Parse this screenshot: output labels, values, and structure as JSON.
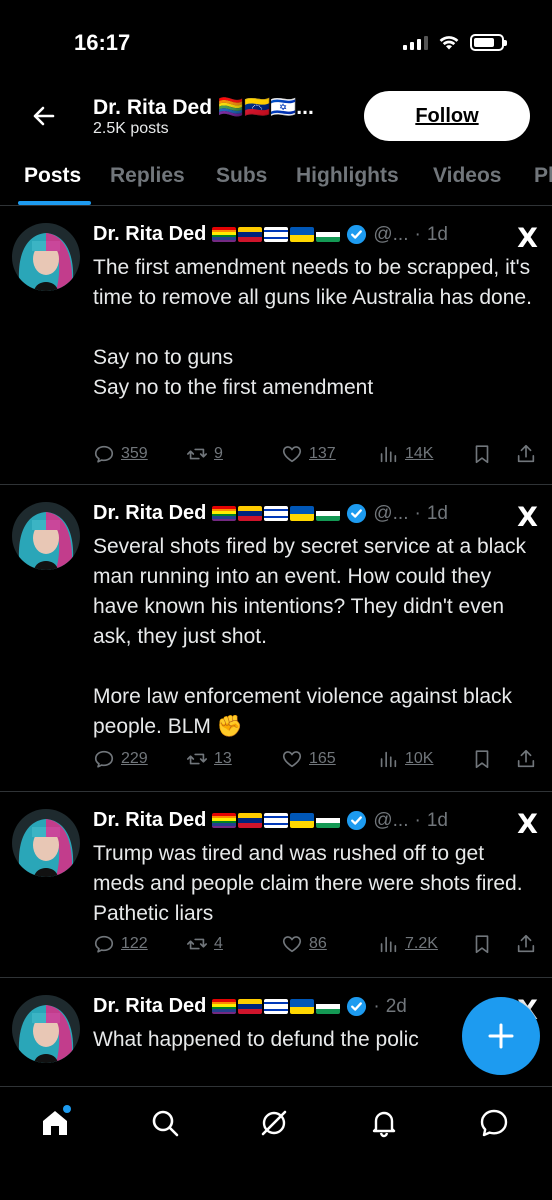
{
  "status_bar": {
    "time": "16:17",
    "battery_level": 0.75
  },
  "header": {
    "profile_name": "Dr. Rita Ded 🏳️‍🌈🇻🇪🇮🇱...",
    "post_count": "2.5K posts",
    "follow_label": "Follow"
  },
  "tabs": [
    "Posts",
    "Replies",
    "Subs",
    "Highlights",
    "Videos",
    "Pl"
  ],
  "colors": {
    "accent": "#1d9bf0",
    "muted": "#71767b",
    "divider": "#2f3336"
  },
  "posts": [
    {
      "author": "Dr. Rita Ded",
      "handle": "@...",
      "dot": "·",
      "time": "1d",
      "text": "The first amendment needs to be scrapped, it's time to remove all guns like Australia has done.\n\nSay no to guns\nSay no to the first amendment",
      "replies": "359",
      "reposts": "9",
      "likes": "137",
      "views": "14K"
    },
    {
      "author": "Dr. Rita Ded",
      "handle": "@...",
      "dot": "·",
      "time": "1d",
      "text": "Several shots fired by secret service at a black man running into an event. How could they have known his intentions? They didn't even ask, they just shot.\n\nMore law enforcement violence against black people. BLM ✊",
      "replies": "229",
      "reposts": "13",
      "likes": "165",
      "views": "10K"
    },
    {
      "author": "Dr. Rita Ded",
      "handle": "@...",
      "dot": "·",
      "time": "1d",
      "text": "Trump was tired and was rushed off to get meds and people claim there were shots fired. Pathetic liars",
      "replies": "122",
      "reposts": "4",
      "likes": "86",
      "views": "7.2K"
    },
    {
      "author": "Dr. Rita Ded",
      "handle": "",
      "dot": "·",
      "time": "2d",
      "text": "What happened to defund the polic"
    }
  ],
  "icons": {
    "back": "arrow-left-icon",
    "x_logo": "X",
    "fab": "plus-icon",
    "nav": [
      "home-icon",
      "search-icon",
      "grok-icon",
      "notifications-icon",
      "messages-icon"
    ]
  }
}
